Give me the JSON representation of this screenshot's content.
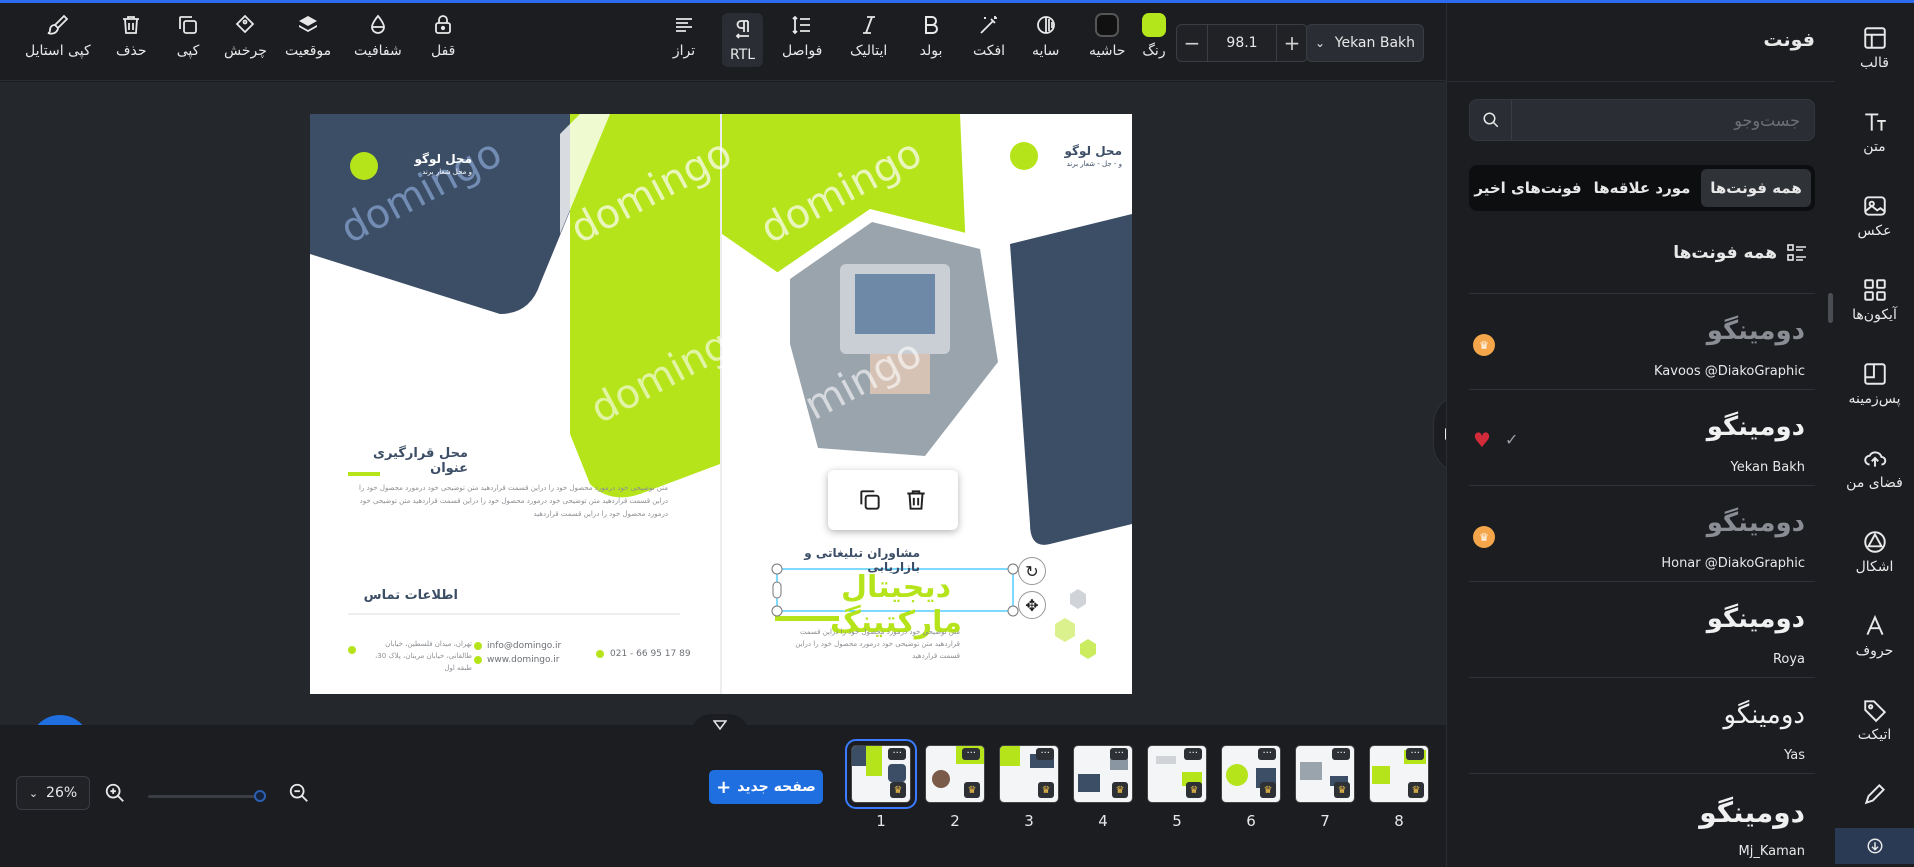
{
  "toolbar": {
    "left_tools": [
      {
        "label": "کپی استایل",
        "icon": "paintbrush-icon"
      },
      {
        "label": "حذف",
        "icon": "trash-icon"
      },
      {
        "label": "کپی",
        "icon": "copy-icon"
      },
      {
        "label": "چرخش",
        "icon": "rotate-icon"
      },
      {
        "label": "موقعیت",
        "icon": "layers-icon"
      },
      {
        "label": "شفافیت",
        "icon": "droplet-icon"
      },
      {
        "label": "قفل",
        "icon": "lock-icon"
      }
    ],
    "text_tools": [
      {
        "label": "تراز",
        "icon": "align-icon"
      },
      {
        "label": "RTL",
        "icon": "pilcrow-icon"
      },
      {
        "label": "فواصل",
        "icon": "spacing-icon"
      },
      {
        "label": "ایتالیک",
        "icon": "italic-icon"
      },
      {
        "label": "بولد",
        "icon": "bold-icon"
      },
      {
        "label": "افکت",
        "icon": "magic-wand-icon"
      },
      {
        "label": "سایه",
        "icon": "shadow-icon"
      },
      {
        "label": "حاشیه",
        "icon": "border-icon"
      },
      {
        "label": "رنگ",
        "icon": "color-icon"
      }
    ],
    "border_color": "#111111",
    "text_color": "#b4e61c",
    "font_size": "98.1",
    "font_name": "Yekan Bakh"
  },
  "font_panel": {
    "title": "فونت",
    "search_placeholder": "جست‌وجو",
    "tabs": [
      "همه فونت‌ها",
      "مورد علاقه‌ها",
      "فونت‌های اخیر"
    ],
    "section_title": "همه فونت‌ها",
    "fonts": [
      {
        "sample": "دومینگو",
        "name": "Kavoos @DiakoGraphic",
        "premium": true
      },
      {
        "sample": "دومینگو",
        "name": "Yekan Bakh",
        "favorite": true,
        "selected": true
      },
      {
        "sample": "دومینگو",
        "name": "Honar @DiakoGraphic",
        "premium": true
      },
      {
        "sample": "دومینگو",
        "name": "Roya"
      },
      {
        "sample": "دومینگو",
        "name": "Yas"
      },
      {
        "sample": "دومینگو",
        "name": "Mj_Kaman"
      }
    ]
  },
  "rail": [
    {
      "label": "قالب",
      "icon": "template-icon"
    },
    {
      "label": "متن",
      "icon": "text-icon"
    },
    {
      "label": "عکس",
      "icon": "image-icon"
    },
    {
      "label": "آیکون‌ها",
      "icon": "grid-icon"
    },
    {
      "label": "پس‌زمینه",
      "icon": "background-icon"
    },
    {
      "label": "فضای من",
      "icon": "cloud-upload-icon"
    },
    {
      "label": "اشکال",
      "icon": "shapes-icon"
    },
    {
      "label": "حروف",
      "icon": "letters-icon"
    },
    {
      "label": "اتیکت",
      "icon": "tag-icon"
    },
    {
      "label": "...",
      "icon": "pencil-icon"
    }
  ],
  "canvas": {
    "logo_text_left": "محل لوگو",
    "logo_sub_left": "و محل شعار برند",
    "logo_text_right": "محل لوگو",
    "logo_sub_right": "و - جل - شعار برند",
    "watermark": "domingo",
    "title_placeholder": "محل قرارگیری عنوان",
    "body_text": "متن توضیحی خود درمورد محصول خود را دراین قسمت قراردهید متن توضیحی خود درمورد محصول خود را دراین قسمت قراردهید متن توضیحی خود درمورد محصول خود را دراین قسمت قراردهید متن توضیحی خود درمورد محصول خود را دراین قسمت قراردهید",
    "contact_title": "اطلاعات تماس",
    "address": "تهران، میدان فلسطین، خیابان طالقانی، خیابان مرینان، پلاک 30، طبقه اول",
    "email": "info@domingo.ir",
    "website": "www.domingo.ir",
    "phone": "021 - 66 95 17 89",
    "subtitle": "مشاوران تبلیغاتی و بازاریابی",
    "headline": "دیجیتال مارکتینگ",
    "small_text": "متن توضیحی خود درمورد محصول خود را دراین قسمت قراردهید متن توضیحی خود درمورد محصول خود را دراین قسمت قراردهید"
  },
  "bottom": {
    "zoom": "26%",
    "new_page": "صفحه جدید",
    "pages": [
      "1",
      "2",
      "3",
      "4",
      "5",
      "6",
      "7",
      "8"
    ],
    "active_page": "1"
  }
}
